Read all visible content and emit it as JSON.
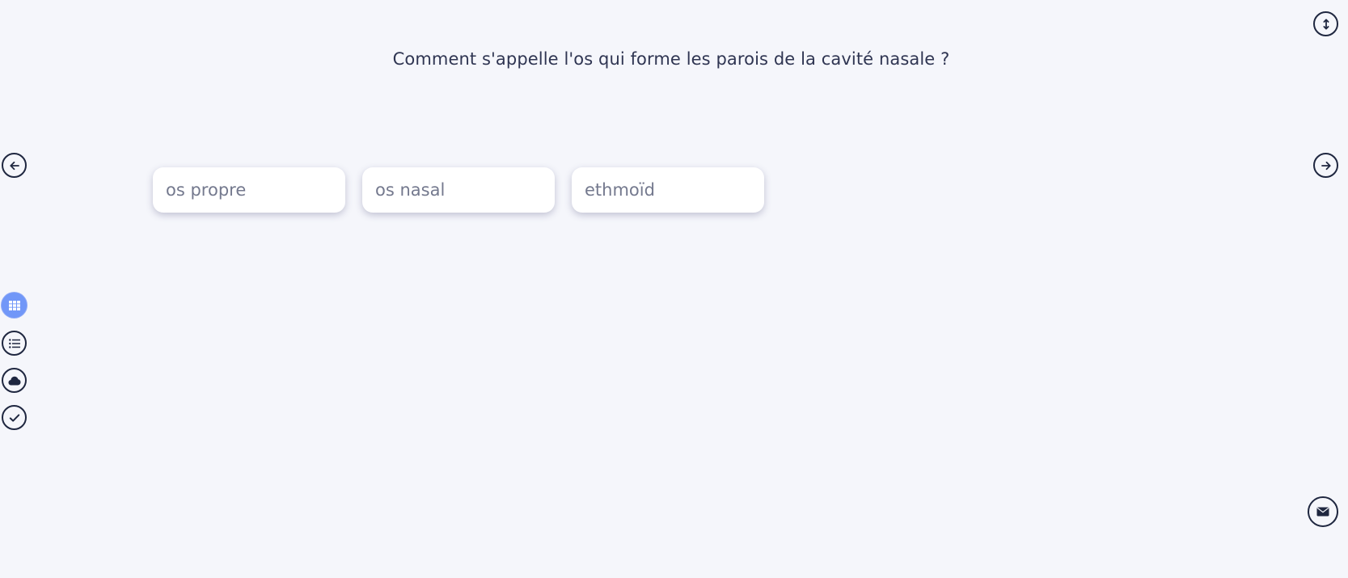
{
  "question": {
    "text": "Comment s'appelle l'os qui forme les parois de la cavité nasale ?"
  },
  "options": [
    {
      "label": "os propre"
    },
    {
      "label": "os nasal"
    },
    {
      "label": "ethmoïd"
    }
  ],
  "navigation": {
    "previous_icon": "arrow-left-icon",
    "next_icon": "arrow-right-icon",
    "expand_icon": "arrow-up-down-icon"
  },
  "view_modes": [
    {
      "icon": "grid-icon",
      "active": true
    },
    {
      "icon": "list-icon",
      "active": false
    },
    {
      "icon": "cloud-icon",
      "active": false
    },
    {
      "icon": "check-icon",
      "active": false
    }
  ],
  "contact": {
    "icon": "envelope-icon"
  },
  "colors": {
    "background": "#f5f6fb",
    "text": "#2f3552",
    "option_text": "#74798e",
    "active_accent": "#7197f8",
    "icon_stroke": "#1f2740"
  }
}
